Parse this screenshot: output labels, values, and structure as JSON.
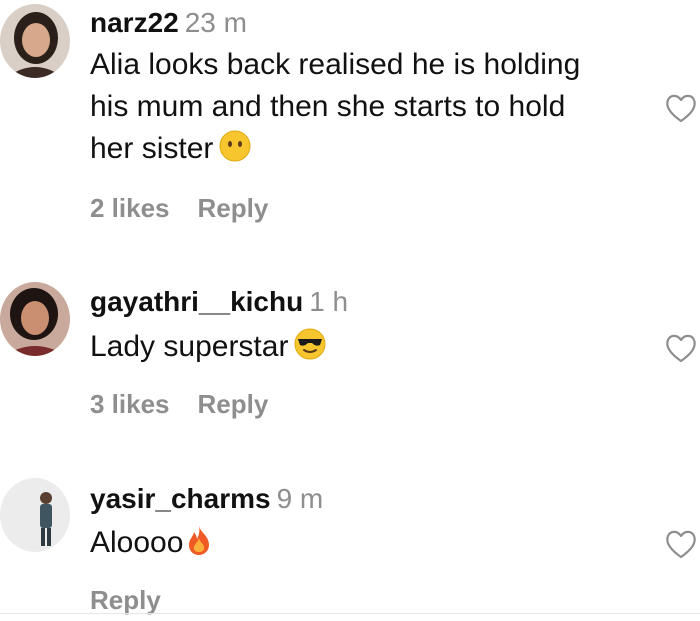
{
  "comments": [
    {
      "username": "narz22",
      "time": "23 m",
      "text_lines": [
        "Alia looks back realised he is holding",
        "his mum and then she starts to hold",
        "her sister"
      ],
      "emoji": "neutral-face-emoji",
      "likes": "2 likes",
      "reply": "Reply"
    },
    {
      "username": "gayathri__kichu",
      "time": "1 h",
      "text_lines": [
        "Lady superstar"
      ],
      "emoji": "sunglasses-face-emoji",
      "likes": "3 likes",
      "reply": "Reply"
    },
    {
      "username": "yasir_charms",
      "time": "9 m",
      "text_lines": [
        "Aloooo"
      ],
      "emoji": "fire-emoji",
      "reply": "Reply"
    }
  ],
  "icons": {
    "like": "heart-outline-icon"
  },
  "colors": {
    "secondary_text": "#8e8e8e",
    "primary_text": "#111111"
  }
}
